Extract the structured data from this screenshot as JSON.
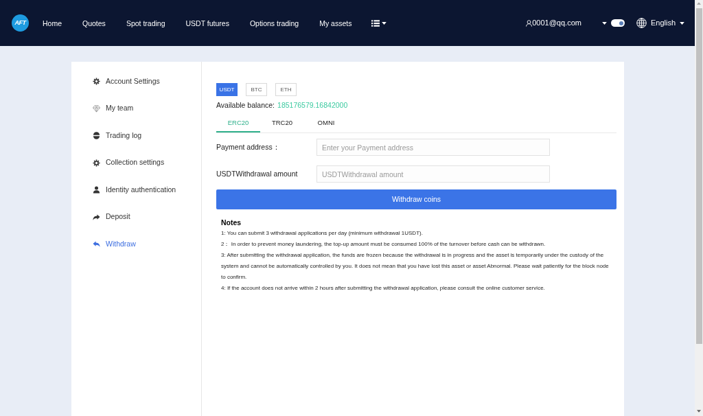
{
  "logo": {
    "text": "AFT"
  },
  "nav": {
    "items": [
      {
        "label": "Home"
      },
      {
        "label": "Quotes"
      },
      {
        "label": "Spot trading"
      },
      {
        "label": "USDT futures"
      },
      {
        "label": "Options trading"
      },
      {
        "label": "My assets"
      }
    ]
  },
  "user": {
    "email": "0001@qq.com"
  },
  "theme_toggle": {
    "on": true
  },
  "language": {
    "label": "English"
  },
  "sidebar": {
    "items": [
      {
        "label": "Account Settings",
        "kind": "gear",
        "selected": false
      },
      {
        "label": "My team",
        "kind": "diamond",
        "selected": false
      },
      {
        "label": "Trading log",
        "kind": "disc",
        "selected": false
      },
      {
        "label": "Collection settings",
        "kind": "gear",
        "selected": false
      },
      {
        "label": "Identity authentication",
        "kind": "person",
        "selected": false
      },
      {
        "label": "Deposit",
        "kind": "forward",
        "selected": false
      },
      {
        "label": "Withdraw",
        "kind": "reply",
        "selected": true
      }
    ]
  },
  "currencies": [
    {
      "label": "USDT",
      "selected": true
    },
    {
      "label": "BTC",
      "selected": false
    },
    {
      "label": "ETH",
      "selected": false
    }
  ],
  "balance": {
    "label": "Available balance:",
    "value": "185176579.16842000"
  },
  "network_tabs": [
    {
      "label": "ERC20",
      "selected": true
    },
    {
      "label": "TRC20",
      "selected": false
    },
    {
      "label": "OMNI",
      "selected": false
    }
  ],
  "form": {
    "fields": [
      {
        "label": "Payment address：",
        "placeholder": "Enter your Payment address"
      },
      {
        "label": "USDTWithdrawal amount",
        "placeholder": "USDTWithdrawal amount"
      }
    ],
    "submit": "Withdraw coins"
  },
  "notes": {
    "title": "Notes",
    "items": [
      "1: You can submit 3 withdrawal applications per day (minimum withdrawal 1USDT).",
      "2： In order to prevent money laundering, the top-up amount must be consumed 100% of the turnover before cash can be withdrawn.",
      "3: After submitting the withdrawal application, the funds are frozen because the withdrawal is in progress and the asset is temporarily under the custody of the system and cannot be automatically controlled by you. It does not mean that you have lost this asset or asset Abnormal. Please wait patiently for the block node to confirm.",
      "4: If the account does not arrive within 2 hours after submitting the withdrawal application, please consult the online customer service."
    ]
  }
}
